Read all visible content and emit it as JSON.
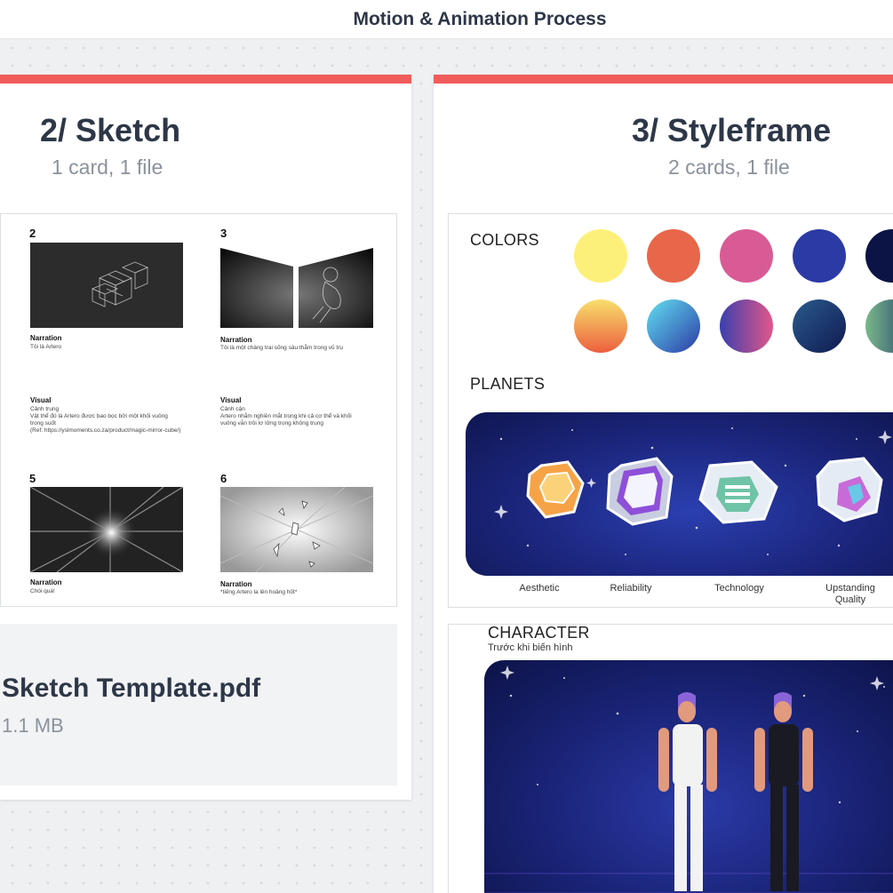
{
  "topbar": {
    "title": "Motion & Animation Process"
  },
  "columns": [
    {
      "title": "2/ Sketch",
      "subtitle": "1 card, 1 file",
      "accent_color": "#f25b5b"
    },
    {
      "title": "3/ Styleframe",
      "subtitle": "2 cards, 1 file",
      "accent_color": "#f25b5b"
    }
  ],
  "sketch_card": {
    "panels": [
      {
        "number": "2",
        "narration_label": "Narration",
        "narration_text": "Tôi là Artero",
        "visual_label": "Visual",
        "visual_text": "Cảnh trung\nVật thể đó là Artero được bao bọc bởi một khối vuông trong suốt\n(Ref: https://yslmoments.co.za/product/magic-mirror-cube/)"
      },
      {
        "number": "3",
        "narration_label": "Narration",
        "narration_text": "Tôi là một chàng trai sống sâu thẳm trong vũ trụ",
        "visual_label": "Visual",
        "visual_text": "Cảnh cận\nArtero nhắm nghiền mắt trong khi cả cơ thể và khối vuông vẫn trôi lơ lửng trong không trung"
      },
      {
        "number": "5",
        "narration_label": "Narration",
        "narration_text": "Chói quá!"
      },
      {
        "number": "6",
        "narration_label": "Narration",
        "narration_text": "*tiếng Artero la lên hoảng hốt*"
      }
    ]
  },
  "file_card": {
    "name": "Sketch Template.pdf",
    "size": "1.1 MB",
    "icon": "pdf-file-icon"
  },
  "styleframe_card": {
    "colors_label": "COLORS",
    "planets_label": "PLANETS",
    "swatches": [
      "#fdf07a",
      "#e8674a",
      "#d95b95",
      "#2c3aa6",
      "#0b1445"
    ],
    "gradient_swatches": [
      [
        "#f8df6d",
        "#ec5f3e"
      ],
      [
        "#62e0f0",
        "#2c3aa6"
      ],
      [
        "#3a3fae",
        "#e35688"
      ],
      [
        "#2b5b8c",
        "#0f1a52"
      ],
      [
        "#7ab88a",
        "#1e3a6a"
      ]
    ],
    "planets": [
      "Aesthetic",
      "Reliability",
      "Technology",
      "Upstanding Quality"
    ]
  },
  "character_card": {
    "label": "CHARACTER",
    "sublabel": "Trước khi biến hình"
  }
}
